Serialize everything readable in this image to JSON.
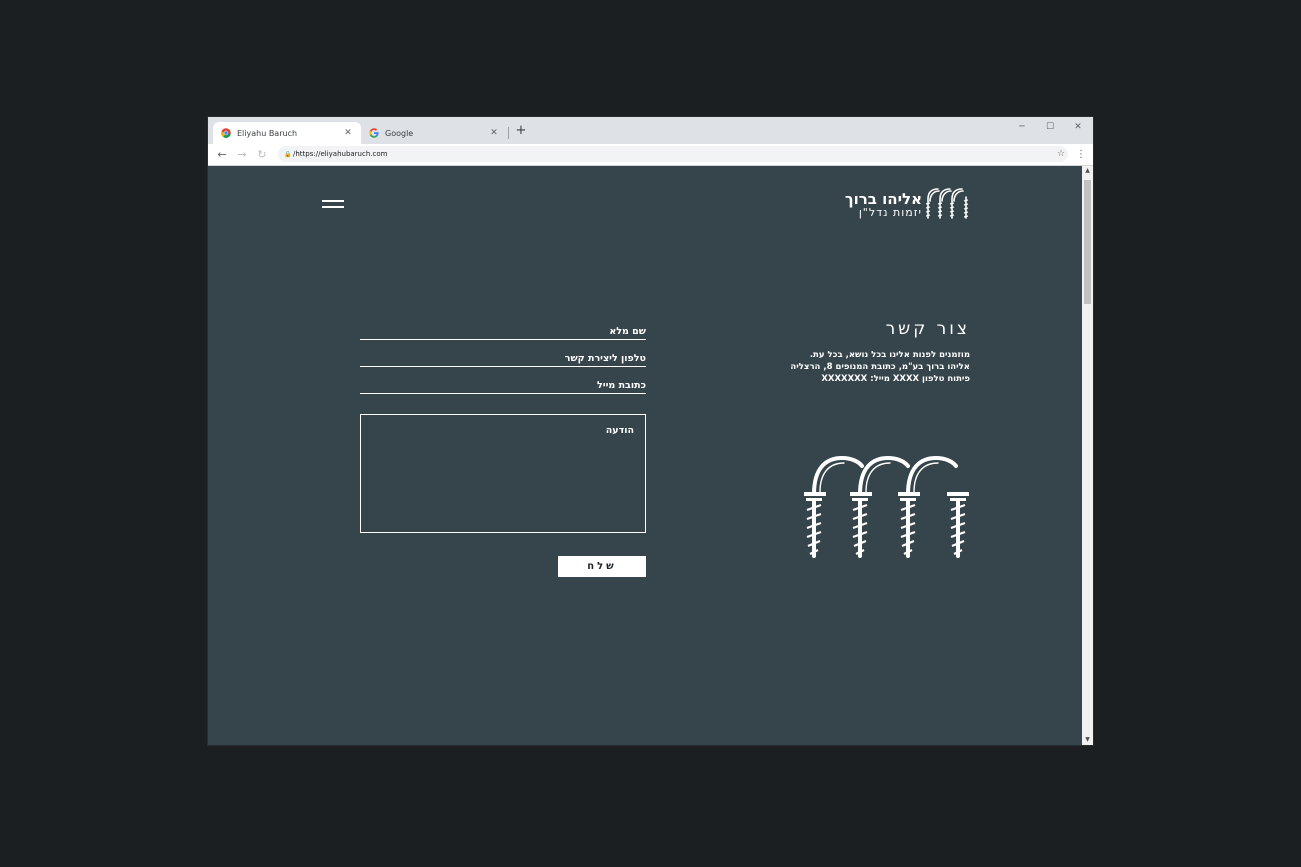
{
  "browser": {
    "tabs": [
      {
        "label": "Eliyahu Baruch",
        "active": true
      },
      {
        "label": "Google",
        "active": false
      }
    ],
    "new_tab": "+",
    "url": "/https://eliyahubaruch.com",
    "controls": {
      "minimize": "─",
      "maximize": "☐",
      "close": "✕"
    },
    "nav": {
      "back": "←",
      "forward": "→",
      "reload": "↻"
    },
    "star": "☆",
    "menu": "⋮",
    "tab_close": "✕",
    "scroll_up": "▲",
    "scroll_down": "▼"
  },
  "site": {
    "logo": {
      "name": "אליהו ברוך",
      "subtitle": "יזמות נדל\"ן"
    },
    "contact": {
      "title": "צור קשר",
      "lines": [
        "מוזמנים לפנות אלינו בכל נושא, בכל עת.",
        "אליהו ברוך בע\"מ, כתובת המנופים 8, הרצליה",
        "פיתוח טלפון XXXX מייל: XXXXXXX"
      ]
    },
    "form": {
      "full_name": "שם מלא",
      "phone": "טלפון ליצירת קשר",
      "email": "כתובת מייל",
      "message": "הודעה",
      "submit": "שלח"
    }
  },
  "colors": {
    "page_bg": "#36444c",
    "outer_bg": "#1c1f22",
    "foreground": "#ffffff"
  },
  "icons": [
    "chrome-icon",
    "google-icon",
    "lock-icon",
    "star-icon",
    "menu-dots-icon",
    "hamburger-icon",
    "logo-arches-icon"
  ]
}
